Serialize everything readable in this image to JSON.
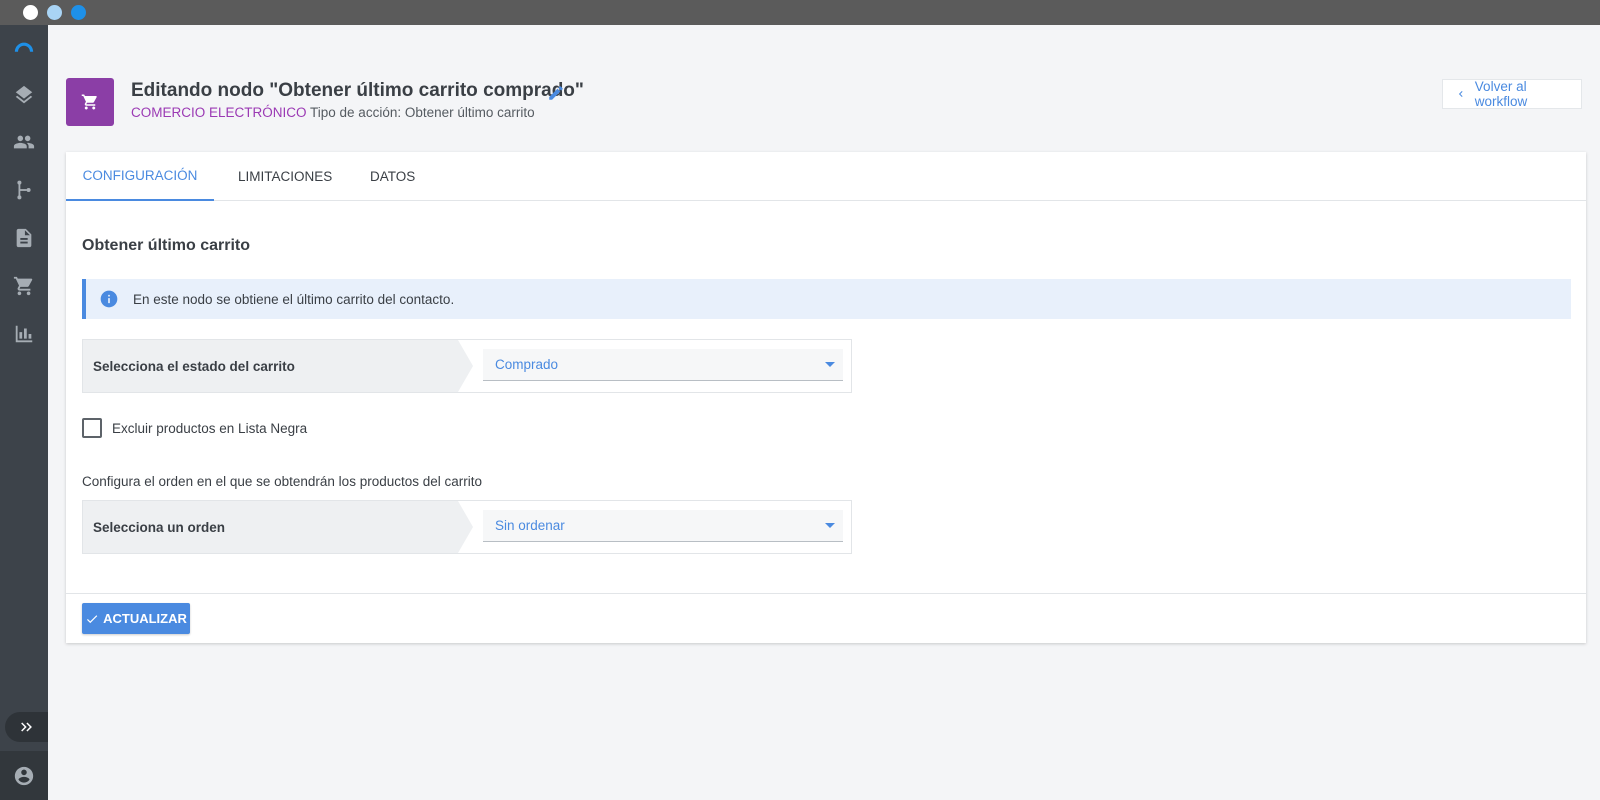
{
  "window": {
    "controls": [
      "close-dot",
      "minimize-dot",
      "maximize-dot"
    ]
  },
  "sidebar": {
    "items": [
      {
        "name": "logo",
        "icon": "arc-logo-icon"
      },
      {
        "name": "layers",
        "icon": "layers-icon"
      },
      {
        "name": "contacts",
        "icon": "people-icon"
      },
      {
        "name": "workflows",
        "icon": "workflow-icon"
      },
      {
        "name": "documents",
        "icon": "document-icon"
      },
      {
        "name": "ecommerce",
        "icon": "cart-icon"
      },
      {
        "name": "reports",
        "icon": "bar-chart-icon"
      }
    ],
    "expand_icon": "double-chevron-right-icon",
    "user_icon": "account-circle-icon"
  },
  "header": {
    "node_icon": "cart-icon",
    "node_icon_color": "#8b3ea6",
    "title": "Editando nodo \"Obtener último carrito comprado\"",
    "category": "COMERCIO ELECTRÓNICO",
    "action_type": "Tipo de acción: Obtener último carrito",
    "back_label": "Volver al workflow"
  },
  "tabs": [
    {
      "label": "CONFIGURACIÓN",
      "active": true
    },
    {
      "label": "LIMITACIONES",
      "active": false
    },
    {
      "label": "DATOS",
      "active": false
    }
  ],
  "content": {
    "section_title": "Obtener último carrito",
    "info_text": "En este nodo se obtiene el último carrito del contacto.",
    "cart_state": {
      "label": "Selecciona el estado del carrito",
      "value": "Comprado"
    },
    "exclude_blacklist": {
      "label": "Excluir productos en Lista Negra",
      "checked": false
    },
    "order_description": "Configura el orden en el que se obtendrán los productos del carrito",
    "order": {
      "label": "Selecciona un orden",
      "value": "Sin ordenar"
    }
  },
  "footer": {
    "update_label": "ACTUALIZAR"
  },
  "colors": {
    "accent": "#4a8ae0",
    "category": "#9b3ab4",
    "sidebar": "#3d434a"
  }
}
